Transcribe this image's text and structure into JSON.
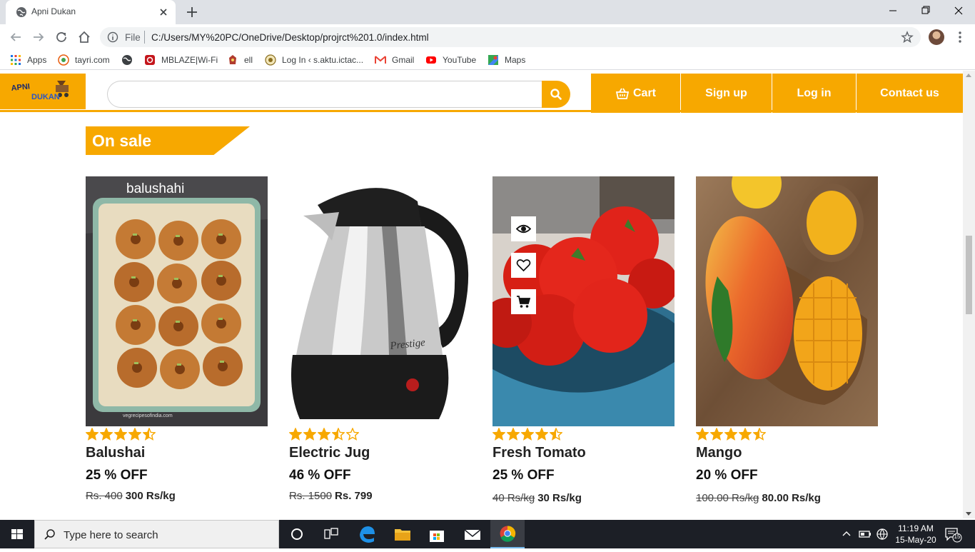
{
  "browser": {
    "tab_title": "Apni Dukan",
    "address_scheme": "File",
    "url": "C:/Users/MY%20PC/OneDrive/Desktop/projrct%201.0/index.html"
  },
  "bookmarks": [
    {
      "label": "Apps",
      "icon": "apps-grid-icon"
    },
    {
      "label": "tayri.com",
      "icon": "tayri-icon"
    },
    {
      "label": "",
      "icon": "globe-icon"
    },
    {
      "label": "MBLAZE|Wi-Fi",
      "icon": "mblaze-icon"
    },
    {
      "label": "ell",
      "icon": "ell-icon"
    },
    {
      "label": "Log In ‹ s.aktu.ictac...",
      "icon": "aktu-icon"
    },
    {
      "label": "Gmail",
      "icon": "gmail-icon"
    },
    {
      "label": "YouTube",
      "icon": "youtube-icon"
    },
    {
      "label": "Maps",
      "icon": "maps-icon"
    }
  ],
  "site": {
    "logo_text_top": "APNI",
    "logo_text_bottom": "DUKAN",
    "search_placeholder": "",
    "nav": [
      {
        "label": "Cart",
        "icon": "cart-icon"
      },
      {
        "label": "Sign up"
      },
      {
        "label": "Log in"
      },
      {
        "label": "Contact us"
      }
    ],
    "accent_color": "#f7a800"
  },
  "section": {
    "title": "On sale"
  },
  "products": [
    {
      "name": "Balushai",
      "discount": "25 % OFF",
      "old_price": "Rs. 400",
      "price": "300 Rs/kg",
      "rating": 4.5,
      "image_caption": "balushahi",
      "image_watermark": "vegrecipesofindia.com"
    },
    {
      "name": "Electric Jug",
      "discount": "46 % OFF",
      "old_price": "Rs. 1500",
      "price": "Rs. 799",
      "rating": 3.5,
      "image_brand": "Prestige"
    },
    {
      "name": "Fresh Tomato",
      "discount": "25 % OFF",
      "old_price": "40 Rs/kg",
      "price": "30 Rs/kg",
      "rating": 4.5
    },
    {
      "name": "Mango",
      "discount": "20 % OFF",
      "old_price": "100.00 Rs/kg",
      "price": "80.00 Rs/kg",
      "rating": 4.5
    }
  ],
  "taskbar": {
    "search_placeholder": "Type here to search",
    "time": "11:19 AM",
    "date": "15-May-20",
    "notifications": "15"
  }
}
